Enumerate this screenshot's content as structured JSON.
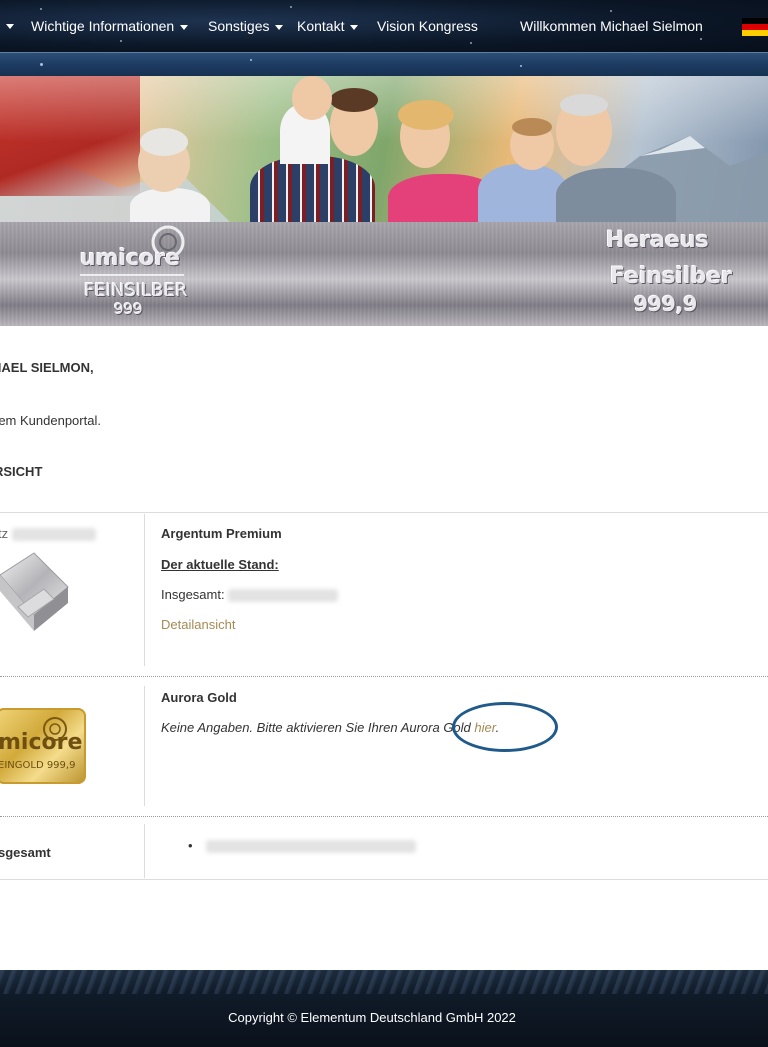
{
  "nav": {
    "items": [
      {
        "label": "Wichtige Informationen",
        "dropdown": true
      },
      {
        "label": "Sonstiges",
        "dropdown": true
      },
      {
        "label": "Kontakt",
        "dropdown": true
      },
      {
        "label": "Vision Kongress",
        "dropdown": false
      }
    ],
    "welcome": "Willkommen Michael Sielmon",
    "language_flag": "de-flag-icon"
  },
  "banner": {
    "left_bar": {
      "brand": "umicore",
      "line1": "FEINSILBER",
      "line2": "999"
    },
    "right_bar": {
      "brand": "Heraeus",
      "line1": "Feinsilber",
      "line2": "999,9"
    }
  },
  "content": {
    "greeting": "HAEL SIELMON,",
    "intro": "rem Kundenportal.",
    "section_title": "RSICHT"
  },
  "products": [
    {
      "left_label_fragment": "tz",
      "name": "Argentum Premium",
      "status_label": "Der aktuelle Stand:",
      "total_label": "Insgesamt:",
      "detail_link": "Detailansicht"
    },
    {
      "name": "Aurora Gold",
      "message_before": "Keine Angaben. Bitte aktivieren Sie Ihren Aurora Gold ",
      "message_link": "hier",
      "message_after": ".",
      "gold_bar": {
        "brand": "micore",
        "line": "EINGOLD 999,9"
      }
    }
  ],
  "summary": {
    "label": "sgesamt"
  },
  "footer": {
    "copyright": "Copyright © Elementum Deutschland GmbH 2022"
  },
  "colors": {
    "link": "#a58a55",
    "highlight_circle": "#1f5a8a",
    "nav_bg": "#0b1626"
  }
}
